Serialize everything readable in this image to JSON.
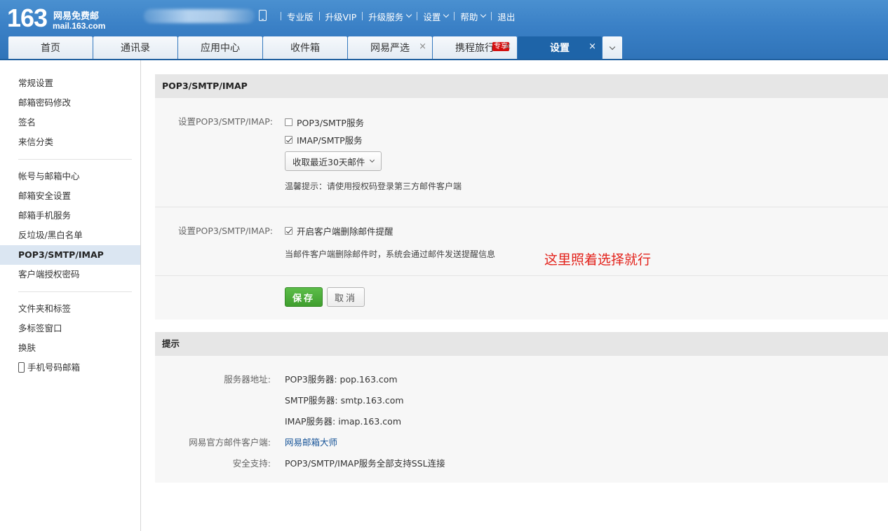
{
  "header": {
    "logo_number": "163",
    "logo_name": "网易免费邮",
    "logo_domain": "mail.163.com",
    "nav": [
      {
        "label": "专业版",
        "dropdown": false
      },
      {
        "label": "升级VIP",
        "dropdown": false
      },
      {
        "label": "升级服务",
        "dropdown": true
      },
      {
        "label": "设置",
        "dropdown": true
      },
      {
        "label": "帮助",
        "dropdown": true
      },
      {
        "label": "退出",
        "dropdown": false
      }
    ]
  },
  "tabs": [
    {
      "label": "首页",
      "closable": false,
      "active": false,
      "badge": ""
    },
    {
      "label": "通讯录",
      "closable": false,
      "active": false,
      "badge": ""
    },
    {
      "label": "应用中心",
      "closable": false,
      "active": false,
      "badge": ""
    },
    {
      "label": "收件箱",
      "closable": false,
      "active": false,
      "badge": ""
    },
    {
      "label": "网易严选",
      "closable": true,
      "active": false,
      "badge": ""
    },
    {
      "label": "携程旅行",
      "closable": true,
      "active": false,
      "badge": "专享"
    },
    {
      "label": "设置",
      "closable": true,
      "active": true,
      "badge": ""
    }
  ],
  "close_glyph": "×",
  "sidebar": {
    "group1": [
      "常规设置",
      "邮箱密码修改",
      "签名",
      "来信分类"
    ],
    "group2": [
      "帐号与邮箱中心",
      "邮箱安全设置",
      "邮箱手机服务",
      "反垃圾/黑白名单",
      "POP3/SMTP/IMAP",
      "客户端授权密码"
    ],
    "group3": [
      "文件夹和标签",
      "多标签窗口",
      "换肤",
      "手机号码邮箱"
    ],
    "active_item": "POP3/SMTP/IMAP"
  },
  "settings_panel": {
    "title": "POP3/SMTP/IMAP",
    "section1": {
      "label": "设置POP3/SMTP/IMAP:",
      "pop3_smtp_label": "POP3/SMTP服务",
      "pop3_smtp_checked": false,
      "imap_smtp_label": "IMAP/SMTP服务",
      "imap_smtp_checked": true,
      "select_value": "收取最近30天邮件",
      "tip": "温馨提示：请使用授权码登录第三方邮件客户端"
    },
    "section2": {
      "label": "设置POP3/SMTP/IMAP:",
      "delete_notice_label": "开启客户端删除邮件提醒",
      "delete_notice_checked": true,
      "description": "当邮件客户端删除邮件时，系统会通过邮件发送提醒信息",
      "annotation": "这里照着选择就行"
    },
    "save_label": "保存",
    "cancel_label": "取消"
  },
  "tips_panel": {
    "title": "提示",
    "server_label": "服务器地址:",
    "pop3_server": "POP3服务器: pop.163.com",
    "smtp_server": "SMTP服务器: smtp.163.com",
    "imap_server": "IMAP服务器: imap.163.com",
    "client_label": "网易官方邮件客户端:",
    "client_link": "网易邮箱大师",
    "security_label": "安全支持:",
    "security_value": "POP3/SMTP/IMAP服务全部支持SSL连接"
  },
  "colors": {
    "header_blue": "#3a80c6",
    "active_tab": "#1e64a8",
    "save_green": "#4caf3a",
    "annotation_red": "#e3221b",
    "link_blue": "#1a5699"
  }
}
